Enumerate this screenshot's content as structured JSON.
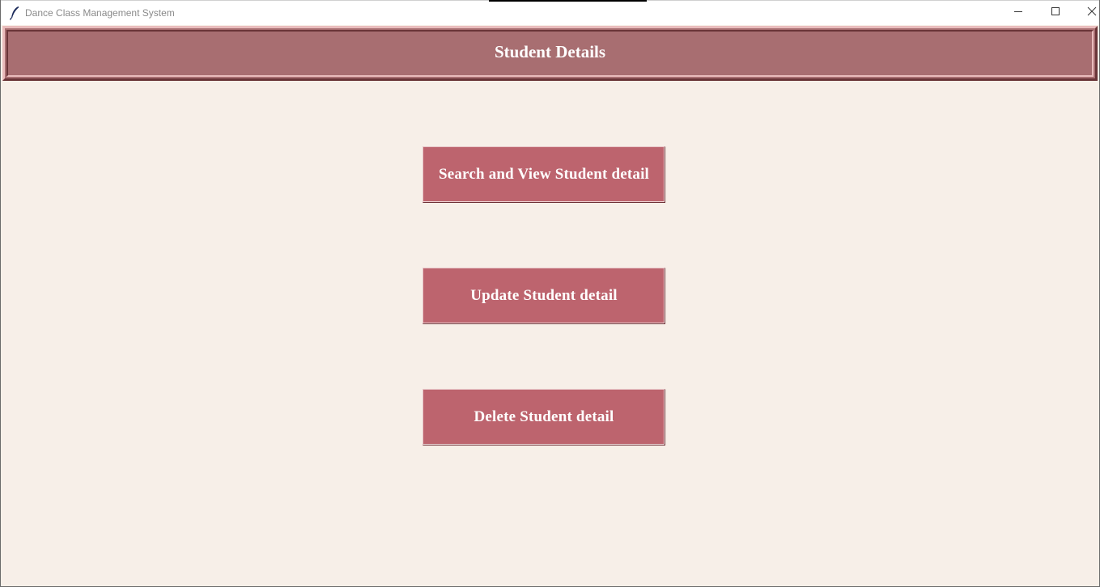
{
  "window": {
    "title": "Dance Class Management System",
    "app_icon": "feather-icon"
  },
  "window_controls": {
    "minimize_icon": "minimize-icon",
    "maximize_icon": "maximize-icon",
    "close_icon": "close-icon"
  },
  "header": {
    "title": "Student Details"
  },
  "actions": {
    "search_label": "Search and View Student detail",
    "update_label": "Update Student detail",
    "delete_label": "Delete Student detail"
  },
  "colors": {
    "background": "#f7efe8",
    "header_bg": "#a86e71",
    "button_bg": "#bd646e",
    "text_light": "#ffffff"
  }
}
